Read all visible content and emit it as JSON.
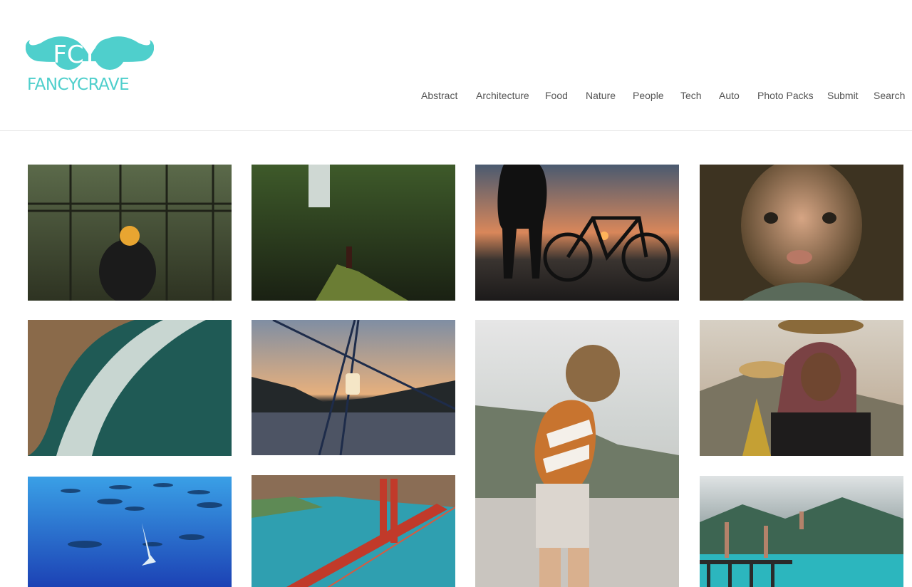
{
  "site": {
    "logo_monogram": "FC",
    "logo_wordmark": "FANCYCRAVE",
    "brand_color": "#4fcfcc"
  },
  "nav": {
    "items": [
      "Abstract",
      "Architecture",
      "Food",
      "Nature",
      "People",
      "Tech",
      "Auto",
      "Photo Packs",
      "Submit",
      "Search"
    ]
  },
  "photos": [
    "person-holding-autumn-leaf-in-greenhouse",
    "hiker-on-forest-path",
    "silhouette-with-bicycle-at-sunset",
    "cracked-porcelain-doll-face",
    "aerial-ocean-waves-on-beach",
    "cable-car-lamp-at-dusk",
    "woman-in-striped-sweater-on-rocky-beach",
    "woman-carrying-basket-on-head",
    "sharks-underwater",
    "aerial-golden-gate-bridge",
    "people-jumping-off-pier-into-sea"
  ]
}
